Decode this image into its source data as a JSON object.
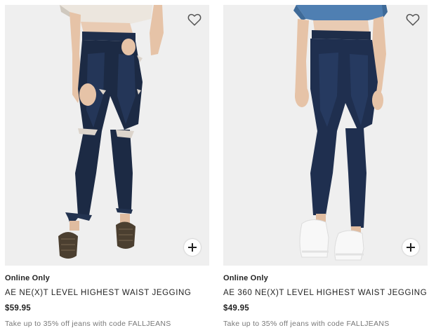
{
  "products": [
    {
      "badge": "Online Only",
      "name": "AE NE(X)T LEVEL HIGHEST WAIST JEGGING",
      "price": "$59.95",
      "promo": "Take up to 35% off jeans with code FALLJEANS",
      "favorite_icon": "heart-outline-icon",
      "add_icon": "plus-icon"
    },
    {
      "badge": "Online Only",
      "name": "AE 360 NE(X)T LEVEL HIGHEST WAIST JEGGING",
      "price": "$49.95",
      "promo": "Take up to 35% off jeans with code FALLJEANS",
      "favorite_icon": "heart-outline-icon",
      "add_icon": "plus-icon"
    }
  ],
  "colors": {
    "denim_dark": "#1c2a44",
    "denim_mid": "#26395a",
    "image_bg": "#efefef",
    "text": "#222222",
    "promo_text": "#777777"
  }
}
